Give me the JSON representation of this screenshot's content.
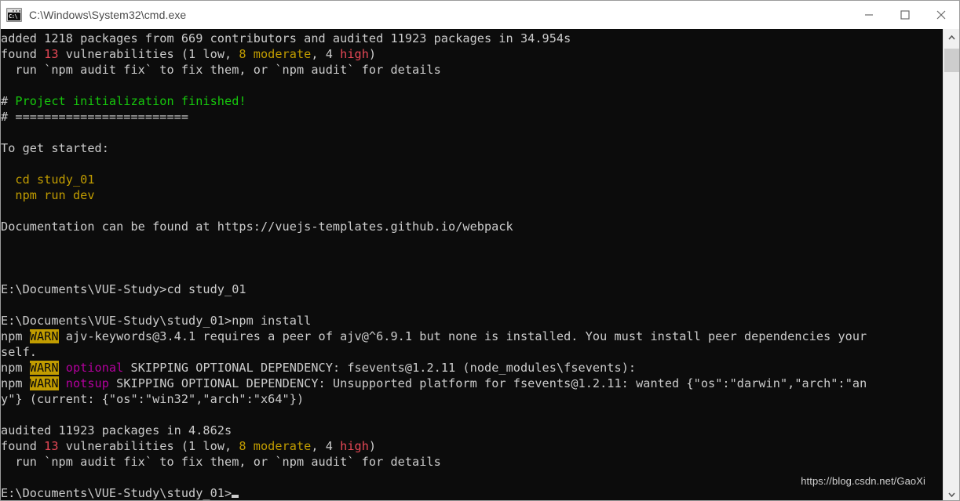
{
  "window": {
    "title": "C:\\Windows\\System32\\cmd.exe",
    "icon": "cmd-console-icon",
    "icon_text": "C:\\",
    "background_color": "#0c0c0c",
    "titlebar_color": "#ffffff",
    "controls": [
      {
        "name": "minimize",
        "glyph": "minimize-icon"
      },
      {
        "name": "maximize",
        "glyph": "maximize-icon"
      },
      {
        "name": "close",
        "glyph": "close-icon"
      }
    ]
  },
  "palette": {
    "foreground": "#cccccc",
    "red": "#e74856",
    "green": "#16c60c",
    "yellow": "#c19c00",
    "magenta": "#b4009e",
    "warn_bg": "#c19c00",
    "warn_fg": "#0c0c0c"
  },
  "terminal": {
    "lines": [
      {
        "text": "added 1218 packages from 669 contributors and audited 11923 packages in 34.954s"
      },
      {
        "text": "found 13 vulnerabilities (1 low, 8 moderate, 4 high)"
      },
      {
        "text": "  run `npm audit fix` to fix them, or `npm audit` for details"
      },
      {
        "text": ""
      },
      {
        "text": "# Project initialization finished!"
      },
      {
        "text": "# ========================"
      },
      {
        "text": ""
      },
      {
        "text": "To get started:"
      },
      {
        "text": ""
      },
      {
        "text": "  cd study_01"
      },
      {
        "text": "  npm run dev"
      },
      {
        "text": ""
      },
      {
        "text": "Documentation can be found at https://vuejs-templates.github.io/webpack"
      },
      {
        "text": ""
      },
      {
        "text": ""
      },
      {
        "text": ""
      },
      {
        "text": "E:\\Documents\\VUE-Study>cd study_01"
      },
      {
        "text": ""
      },
      {
        "text": "E:\\Documents\\VUE-Study\\study_01>npm install"
      },
      {
        "text": "npm WARN ajv-keywords@3.4.1 requires a peer of ajv@^6.9.1 but none is installed. You must install peer dependencies your"
      },
      {
        "text": "self."
      },
      {
        "text": "npm WARN optional SKIPPING OPTIONAL DEPENDENCY: fsevents@1.2.11 (node_modules\\fsevents):"
      },
      {
        "text": "npm WARN notsup SKIPPING OPTIONAL DEPENDENCY: Unsupported platform for fsevents@1.2.11: wanted {\"os\":\"darwin\",\"arch\":\"an"
      },
      {
        "text": "y\"} (current: {\"os\":\"win32\",\"arch\":\"x64\"})"
      },
      {
        "text": ""
      },
      {
        "text": "audited 11923 packages in 4.862s"
      },
      {
        "text": "found 13 vulnerabilities (1 low, 8 moderate, 4 high)"
      },
      {
        "text": "  run `npm audit fix` to fix them, or `npm audit` for details"
      },
      {
        "text": ""
      },
      {
        "text": "E:\\Documents\\VUE-Study\\study_01>"
      }
    ],
    "segments": [
      [
        {
          "t": "added 1218 packages from 669 contributors and audited 11923 packages in 34.954s",
          "c": "white"
        }
      ],
      [
        {
          "t": "found ",
          "c": "white"
        },
        {
          "t": "13",
          "c": "red"
        },
        {
          "t": " vulnerabilities (1 low, ",
          "c": "white"
        },
        {
          "t": "8 moderate",
          "c": "yellow"
        },
        {
          "t": ", 4 ",
          "c": "white"
        },
        {
          "t": "high",
          "c": "red"
        },
        {
          "t": ")",
          "c": "white"
        }
      ],
      [
        {
          "t": "  run `npm audit fix` to fix them, or `npm audit` for details",
          "c": "white"
        }
      ],
      [
        {
          "t": "",
          "c": "white"
        }
      ],
      [
        {
          "t": "# ",
          "c": "white"
        },
        {
          "t": "Project initialization finished!",
          "c": "green"
        }
      ],
      [
        {
          "t": "# ========================",
          "c": "white"
        }
      ],
      [
        {
          "t": "",
          "c": "white"
        }
      ],
      [
        {
          "t": "To get started:",
          "c": "white"
        }
      ],
      [
        {
          "t": "",
          "c": "white"
        }
      ],
      [
        {
          "t": "  ",
          "c": "white"
        },
        {
          "t": "cd study_01",
          "c": "yellow"
        }
      ],
      [
        {
          "t": "  ",
          "c": "white"
        },
        {
          "t": "npm run dev",
          "c": "yellow"
        }
      ],
      [
        {
          "t": "",
          "c": "white"
        }
      ],
      [
        {
          "t": "Documentation can be found at https://vuejs-templates.github.io/webpack",
          "c": "white"
        }
      ],
      [
        {
          "t": "",
          "c": "white"
        }
      ],
      [
        {
          "t": "",
          "c": "white"
        }
      ],
      [
        {
          "t": "",
          "c": "white"
        }
      ],
      [
        {
          "t": "E:\\Documents\\VUE-Study>cd study_01",
          "c": "white"
        }
      ],
      [
        {
          "t": "",
          "c": "white"
        }
      ],
      [
        {
          "t": "E:\\Documents\\VUE-Study\\study_01>npm install",
          "c": "white"
        }
      ],
      [
        {
          "t": "npm ",
          "c": "white"
        },
        {
          "t": "WARN",
          "c": "warn"
        },
        {
          "t": " ajv-keywords@3.4.1 requires a peer of ajv@^6.9.1 but none is installed. You must install peer dependencies your",
          "c": "white"
        }
      ],
      [
        {
          "t": "self.",
          "c": "white"
        }
      ],
      [
        {
          "t": "npm ",
          "c": "white"
        },
        {
          "t": "WARN",
          "c": "warn"
        },
        {
          "t": " ",
          "c": "white"
        },
        {
          "t": "optional",
          "c": "magenta"
        },
        {
          "t": " SKIPPING OPTIONAL DEPENDENCY: fsevents@1.2.11 (node_modules\\fsevents):",
          "c": "white"
        }
      ],
      [
        {
          "t": "npm ",
          "c": "white"
        },
        {
          "t": "WARN",
          "c": "warn"
        },
        {
          "t": " ",
          "c": "white"
        },
        {
          "t": "notsup",
          "c": "magenta"
        },
        {
          "t": " SKIPPING OPTIONAL DEPENDENCY: Unsupported platform for fsevents@1.2.11: wanted {\"os\":\"darwin\",\"arch\":\"an",
          "c": "white"
        }
      ],
      [
        {
          "t": "y\"} (current: {\"os\":\"win32\",\"arch\":\"x64\"})",
          "c": "white"
        }
      ],
      [
        {
          "t": "",
          "c": "white"
        }
      ],
      [
        {
          "t": "audited 11923 packages in 4.862s",
          "c": "white"
        }
      ],
      [
        {
          "t": "found ",
          "c": "white"
        },
        {
          "t": "13",
          "c": "red"
        },
        {
          "t": " vulnerabilities (1 low, ",
          "c": "white"
        },
        {
          "t": "8 moderate",
          "c": "yellow"
        },
        {
          "t": ", 4 ",
          "c": "white"
        },
        {
          "t": "high",
          "c": "red"
        },
        {
          "t": ")",
          "c": "white"
        }
      ],
      [
        {
          "t": "  run `npm audit fix` to fix them, or `npm audit` for details",
          "c": "white"
        }
      ],
      [
        {
          "t": "",
          "c": "white"
        }
      ],
      [
        {
          "t": "E:\\Documents\\VUE-Study\\study_01>",
          "c": "white",
          "cursor": true
        }
      ]
    ],
    "prompt": "E:\\Documents\\VUE-Study\\study_01>",
    "cursor_visible": true
  },
  "watermark": {
    "text": "https://blog.csdn.net/GaoXi"
  },
  "scrollbar": {
    "up_arrow": "chevron-up-icon",
    "down_arrow": "chevron-down-icon",
    "thumb_position_pct": 4
  }
}
